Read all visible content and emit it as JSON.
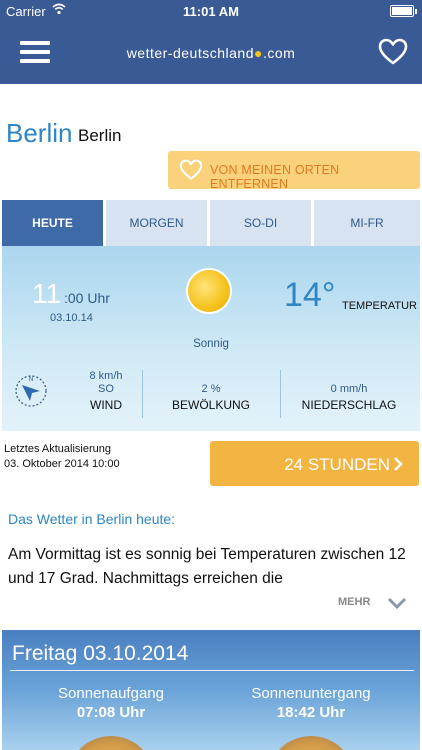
{
  "status_bar": {
    "carrier": "Carrier",
    "time": "11:01 AM"
  },
  "header": {
    "logo_text": "wetter-deutschland",
    "logo_suffix": ".com"
  },
  "city": {
    "name": "Berlin",
    "region": "Berlin"
  },
  "remove_favorite": {
    "label": "VON MEINEN ORTEN ENTFERNEN"
  },
  "tabs": [
    {
      "label": "HEUTE"
    },
    {
      "label": "MORGEN"
    },
    {
      "label": "SO-DI"
    },
    {
      "label": "MI-FR"
    }
  ],
  "current": {
    "hour": "11",
    "minutes_suffix": ":00 Uhr",
    "date": "03.10.14",
    "condition": "Sonnig",
    "temperature": "14°",
    "temperature_label": "TEMPERATUR"
  },
  "metrics": {
    "wind": {
      "value1": "8 km/h",
      "value2": "SO",
      "label": "WIND"
    },
    "cloud": {
      "value": "2 %",
      "label": "BEWÖLKUNG"
    },
    "precip": {
      "value": "0 mm/h",
      "label": "NIEDERSCHLAG"
    }
  },
  "last_update": {
    "label": "Letztes Aktualisierung",
    "value": "03. Oktober 2014 10:00"
  },
  "forecast_button": {
    "label": "24 STUNDEN"
  },
  "description": {
    "heading": "Das Wetter in Berlin heute:",
    "text": "Am Vormittag ist es sonnig bei Temperaturen zwischen 12 und 17 Grad. Nachmittags erreichen die",
    "more_label": "MEHR"
  },
  "day_card": {
    "title": "Freitag 03.10.2014",
    "sunrise_label": "Sonnenaufgang",
    "sunrise_time": "07:08 Uhr",
    "sunset_label": "Sonnenuntergang",
    "sunset_time": "18:42 Uhr"
  },
  "colors": {
    "header_bg": "#3a5a95",
    "accent_blue": "#2f86c4",
    "active_tab": "#3f6aa8",
    "orange_button": "#f3b542",
    "remove_button_bg": "#fbd27c",
    "remove_button_text": "#e07a20"
  },
  "icons": [
    "wifi-icon",
    "battery-icon",
    "menu-icon",
    "heart-icon",
    "sun-icon",
    "compass-icon",
    "chevron-right-icon",
    "chevron-down-icon"
  ]
}
